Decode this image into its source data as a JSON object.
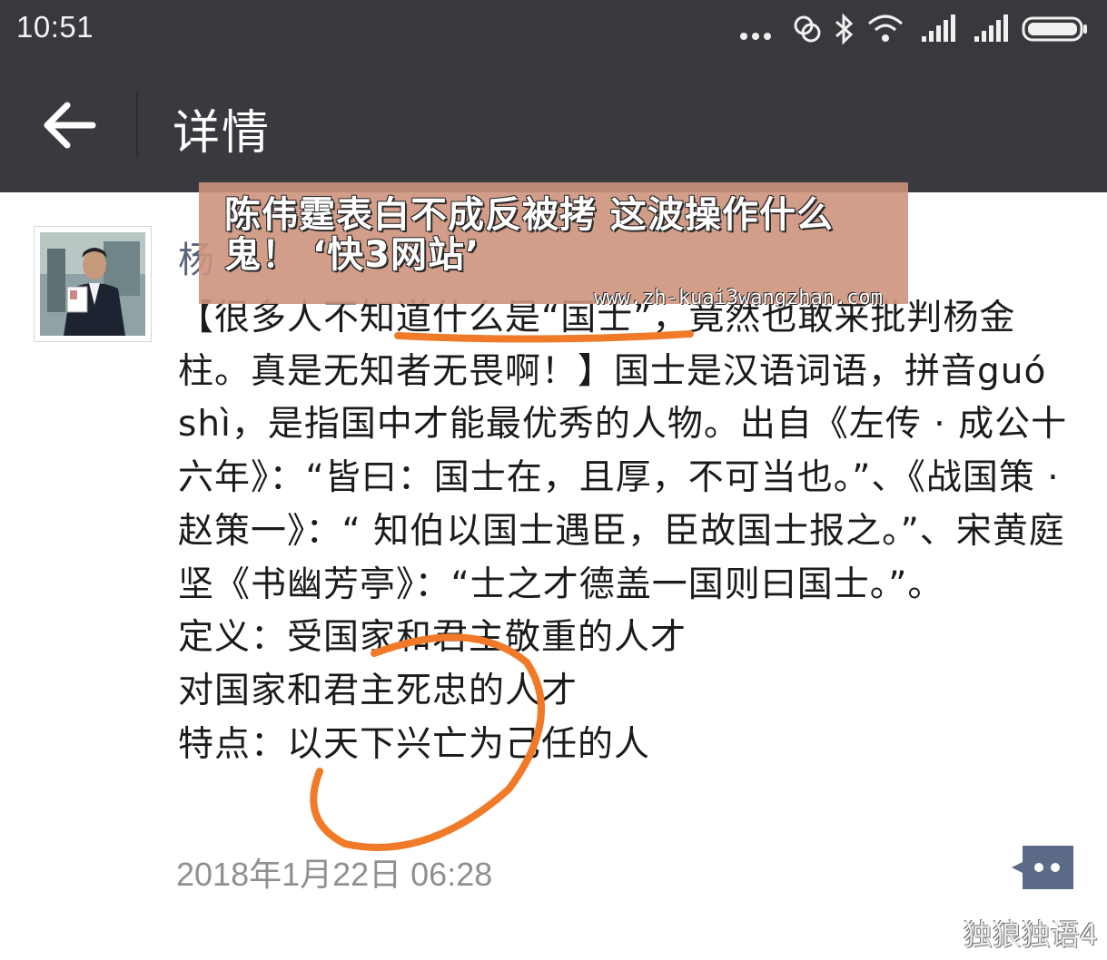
{
  "status_bar": {
    "time": "10:51",
    "icons": [
      "more-dots-icon",
      "sync-icon",
      "bluetooth-icon",
      "wifi-icon",
      "signal-icon",
      "signal-icon",
      "battery-icon"
    ]
  },
  "header": {
    "title": "详情",
    "back_icon": "arrow-left-icon"
  },
  "post": {
    "author": "杨",
    "paragraphs": [
      "【很多人不知道什么是“国士”，竟然也敢来批判杨金柱。真是无知者无畏啊！】国士是汉语词语，拼音guó shì，是指国中才能最优秀的人物。出自《左传 · 成公十六年》：“皆曰：国士在，且厚，不可当也。”、《战国策 · 赵策一》：“ 知伯以国士遇臣，臣故国士报之。”、宋黄庭坚《书幽芳亭》：“士之才德盖一国则曰国士。”。",
      "定义：受国家和君主敬重的人才",
      "对国家和君主死忠的人才",
      "特点：以天下兴亡为己任的人"
    ],
    "timestamp": "2018年1月22日 06:28",
    "comment_icon": "comment-dots-icon"
  },
  "overlay": {
    "caption_title": "陈伟霆表白不成反被拷 这波操作什么鬼！ ‘快3网站’",
    "caption_url": "www.zh-kuai3wangzhan.com",
    "watermark": "独狼独语4",
    "watermark_icon": "weibo-icon",
    "annotation_color": "#f07a28"
  }
}
